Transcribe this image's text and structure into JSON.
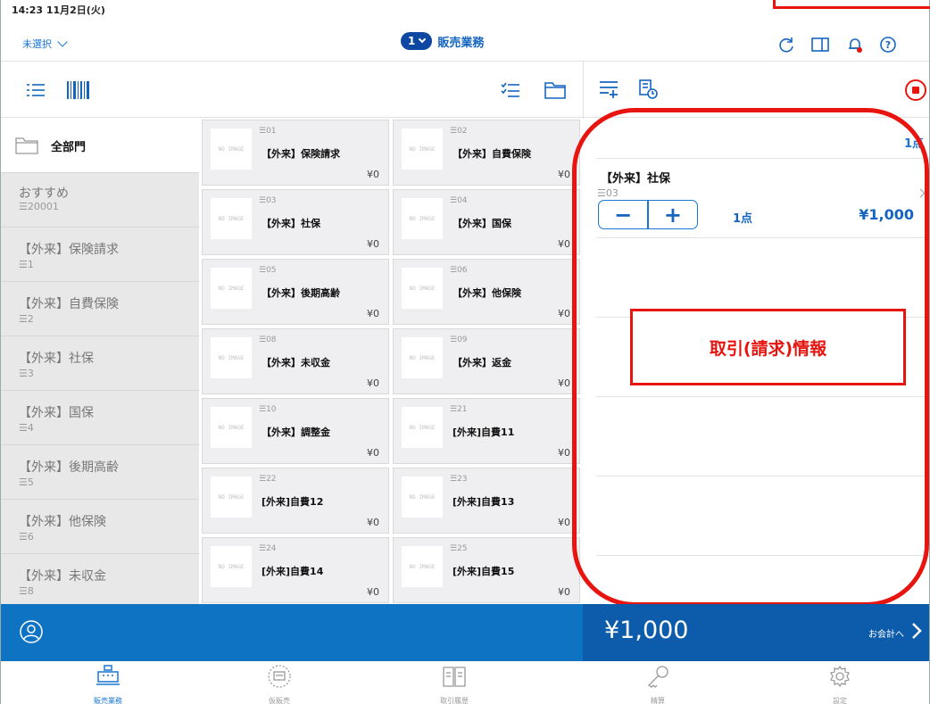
{
  "status": {
    "time_date": "14:23  11月2日(火)"
  },
  "header": {
    "unselected_label": "未選択",
    "badge_number": "1",
    "title": "販売業務"
  },
  "sidebar": {
    "all_departments": "全部門",
    "items": [
      {
        "label": "おすすめ",
        "code": "☰20001"
      },
      {
        "label": "【外来】保険請求",
        "code": "☰1"
      },
      {
        "label": "【外来】自費保険",
        "code": "☰2"
      },
      {
        "label": "【外来】社保",
        "code": "☰3"
      },
      {
        "label": "【外来】国保",
        "code": "☰4"
      },
      {
        "label": "【外来】後期高齢",
        "code": "☰5"
      },
      {
        "label": "【外来】他保険",
        "code": "☰6"
      },
      {
        "label": "【外来】未収金",
        "code": "☰8"
      }
    ]
  },
  "products": {
    "no_image_label": "NO IMAGE",
    "items": [
      {
        "code": "☰01",
        "name": "【外来】保険請求",
        "price": "¥0"
      },
      {
        "code": "☰02",
        "name": "【外来】自費保険",
        "price": "¥0"
      },
      {
        "code": "☰03",
        "name": "【外来】社保",
        "price": "¥0"
      },
      {
        "code": "☰04",
        "name": "【外来】国保",
        "price": "¥0"
      },
      {
        "code": "☰05",
        "name": "【外来】後期高齢",
        "price": "¥0"
      },
      {
        "code": "☰06",
        "name": "【外来】他保険",
        "price": "¥0"
      },
      {
        "code": "☰08",
        "name": "【外来】未収金",
        "price": "¥0"
      },
      {
        "code": "☰09",
        "name": "【外来】返金",
        "price": "¥0"
      },
      {
        "code": "☰10",
        "name": "【外来】調整金",
        "price": "¥0"
      },
      {
        "code": "☰21",
        "name": "[外来]自費11",
        "price": "¥0"
      },
      {
        "code": "☰22",
        "name": "[外来]自費12",
        "price": "¥0"
      },
      {
        "code": "☰23",
        "name": "[外来]自費13",
        "price": "¥0"
      },
      {
        "code": "☰24",
        "name": "[外来]自費14",
        "price": "¥0"
      },
      {
        "code": "☰25",
        "name": "[外来]自費15",
        "price": "¥0"
      }
    ]
  },
  "cart": {
    "total_count": "1点",
    "item": {
      "name": "【外来】社保",
      "code": "☰03",
      "minus": "−",
      "plus": "+",
      "qty": "1点",
      "price": "¥1,000"
    }
  },
  "annotation": {
    "info_label": "取引(請求)情報"
  },
  "bottom": {
    "total": "¥1,000",
    "checkout_label": "お会計へ"
  },
  "tabs": [
    {
      "label": "販売業務",
      "icon": "register-icon"
    },
    {
      "label": "仮販売",
      "icon": "temp-sale-icon"
    },
    {
      "label": "取引履歴",
      "icon": "history-icon"
    },
    {
      "label": "精算",
      "icon": "key-icon"
    },
    {
      "label": "設定",
      "icon": "settings-icon"
    }
  ],
  "colors": {
    "accent": "#1976d2",
    "bottom_bar": "#0f73c4",
    "annotation_red": "#e8140f"
  }
}
